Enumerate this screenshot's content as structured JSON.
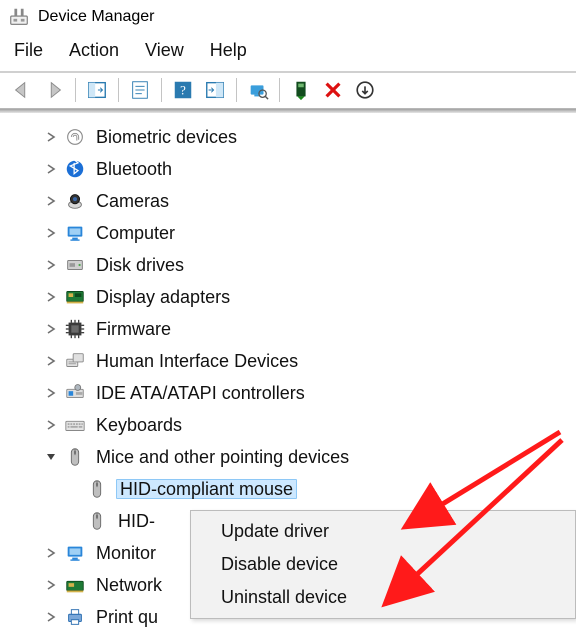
{
  "window": {
    "title": "Device Manager"
  },
  "menu": {
    "file": "File",
    "action": "Action",
    "view": "View",
    "help": "Help"
  },
  "tree": {
    "items": [
      {
        "label": "Biometric devices",
        "icon": "fingerprint"
      },
      {
        "label": "Bluetooth",
        "icon": "bluetooth"
      },
      {
        "label": "Cameras",
        "icon": "camera"
      },
      {
        "label": "Computer",
        "icon": "computer"
      },
      {
        "label": "Disk drives",
        "icon": "disk"
      },
      {
        "label": "Display adapters",
        "icon": "display-adapter"
      },
      {
        "label": "Firmware",
        "icon": "firmware"
      },
      {
        "label": "Human Interface Devices",
        "icon": "hid"
      },
      {
        "label": "IDE ATA/ATAPI controllers",
        "icon": "ide"
      },
      {
        "label": "Keyboards",
        "icon": "keyboard"
      },
      {
        "label": "Mice and other pointing devices",
        "icon": "mouse",
        "expanded": true
      },
      {
        "label": "Monitors",
        "icon": "monitor",
        "partial": "Monitor"
      },
      {
        "label": "Network adapters",
        "icon": "network",
        "partial": "Network"
      },
      {
        "label": "Print queues",
        "icon": "printer",
        "partial": "Print qu"
      }
    ],
    "mice_children": [
      {
        "label": "HID-compliant mouse",
        "selected": true
      },
      {
        "label": "HID-",
        "truncated": true
      }
    ]
  },
  "context_menu": {
    "items": [
      {
        "label": "Update driver"
      },
      {
        "label": "Disable device"
      },
      {
        "label": "Uninstall device"
      }
    ]
  }
}
